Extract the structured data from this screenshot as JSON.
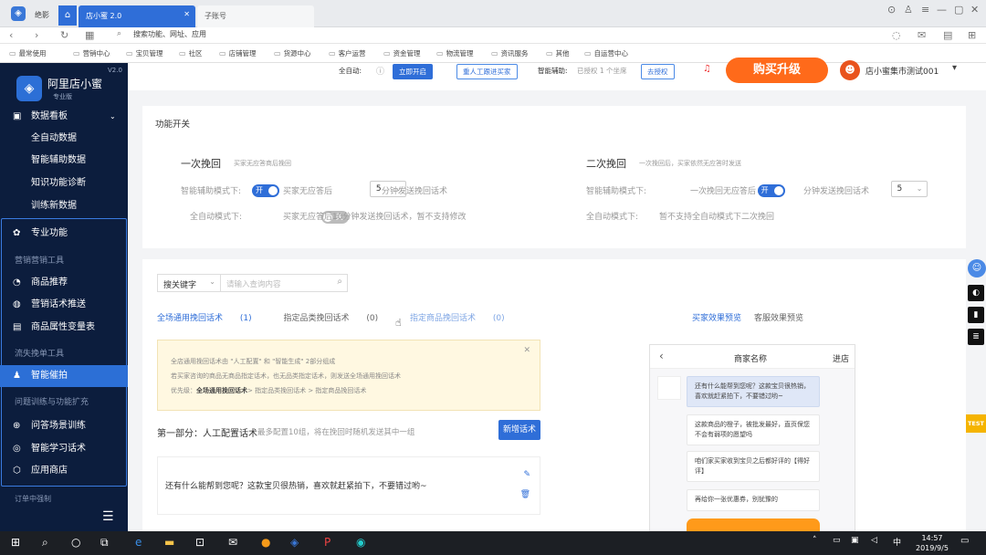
{
  "browser": {
    "app_label": "绝影",
    "tabs": [
      {
        "label": "店小蜜 2.0",
        "active": true
      },
      {
        "label": "子账号",
        "active": false
      }
    ],
    "address_placeholder": "搜索功能、网址、应用",
    "bookmarks": [
      "最常使用",
      "营销中心",
      "宝贝管理",
      "社区",
      "店铺管理",
      "货源中心",
      "客户运营",
      "资金管理",
      "物流管理",
      "资讯服务",
      "其他",
      "自运营中心"
    ]
  },
  "header": {
    "auto_label": "全自动:",
    "start_button": "立即开启",
    "human_button": "重人工跟进买家",
    "assist_label": "智能辅助:",
    "authorized_text": "已授权 1 个坐席",
    "authorize_button": "去授权",
    "buy_button": "购买升级",
    "shop_name": "店小蜜集市测试001"
  },
  "sidebar": {
    "version": "V2.0",
    "app_title": "阿里店小蜜",
    "edition": "专业版",
    "section_data": "数据看板",
    "data_items": [
      "全自动数据",
      "智能辅助数据",
      "知识功能诊断",
      "训练新数据"
    ],
    "pro_label": "专业功能",
    "group_marketing": "营销营销工具",
    "marketing_items": [
      "商品推荐",
      "营销话术推送",
      "商品属性变量表"
    ],
    "group_loss": "流失挽单工具",
    "active_item": "智能催拍",
    "group_train": "问题训练与功能扩充",
    "train_items": [
      "问答场景训练",
      "智能学习话术",
      "应用商店"
    ],
    "bottom_label": "订单中强制"
  },
  "switches": {
    "section_title": "功能开关",
    "first": {
      "title": "一次挽回",
      "hint": "买家无应答商后挽回",
      "assist_label": "智能辅助模式下:",
      "toggle_on": "开",
      "text_before": "买家无应答后",
      "minutes": "5",
      "text_after": "分钟发送挽回话术",
      "auto_label": "全自动模式下:",
      "toggle_off": "关",
      "auto_text": "买家无应答后10分钟发送挽回话术，暂不支持修改"
    },
    "second": {
      "title": "二次挽回",
      "hint": "一次挽回后，买家依然无应答时发送",
      "assist_label": "智能辅助模式下:",
      "toggle_on": "开",
      "text_before": "一次挽回无应答后",
      "minutes": "5",
      "text_after": "分钟发送挽回话术",
      "auto_label": "全自动模式下:",
      "auto_text": "暂不支持全自动模式下二次挽回"
    }
  },
  "scripts": {
    "search_type": "搜关键字",
    "search_placeholder": "请输入查询内容",
    "tabs": [
      {
        "label": "全场通用挽回话术",
        "count": "(1)"
      },
      {
        "label": "指定品类挽回话术",
        "count": "(0)"
      },
      {
        "label": "指定商品挽回话术",
        "count": "(0)"
      }
    ],
    "preview_buyer": "买家效果预览",
    "preview_agent": "客服效果预览",
    "notice_line1": "全店通用挽回话术由 \"人工配置\" 和 \"智能生成\" 2部分组成",
    "notice_line2": "若买家咨询的商品无商品指定话术，也无品类指定话术，则发送全场通用挽回话术",
    "notice_line3_prefix": "优先级：",
    "notice_line3_bold": "全场通用挽回话术",
    "notice_line3_rest": "> 指定品类挽回话术 > 指定商品挽回话术",
    "part1_title": "第一部分：人工配置话术",
    "part1_hint": "最多配置10组，将在挽回时随机发送其中一组",
    "add_button": "新增话术",
    "item_text": "还有什么能帮到您呢？这款宝贝很热销，喜欢就赶紧拍下，不要错过哟~"
  },
  "phone": {
    "title": "商家名称",
    "enter_shop": "进店",
    "bubbles": [
      "还有什么能帮到您呢？这款宝贝很热销，喜欢就赶紧拍下，不要错过哟~",
      "这款商品的橙子，被批发最好，直页保您不会有弱项的愿望吗",
      "咱们家买家收到宝贝之后都好评的【得好评】",
      "再给你一张优惠券，别犹豫的"
    ]
  },
  "taskbar": {
    "time": "14:57",
    "date": "2019/9/5",
    "lang": "中"
  },
  "badge_test": "TEST"
}
